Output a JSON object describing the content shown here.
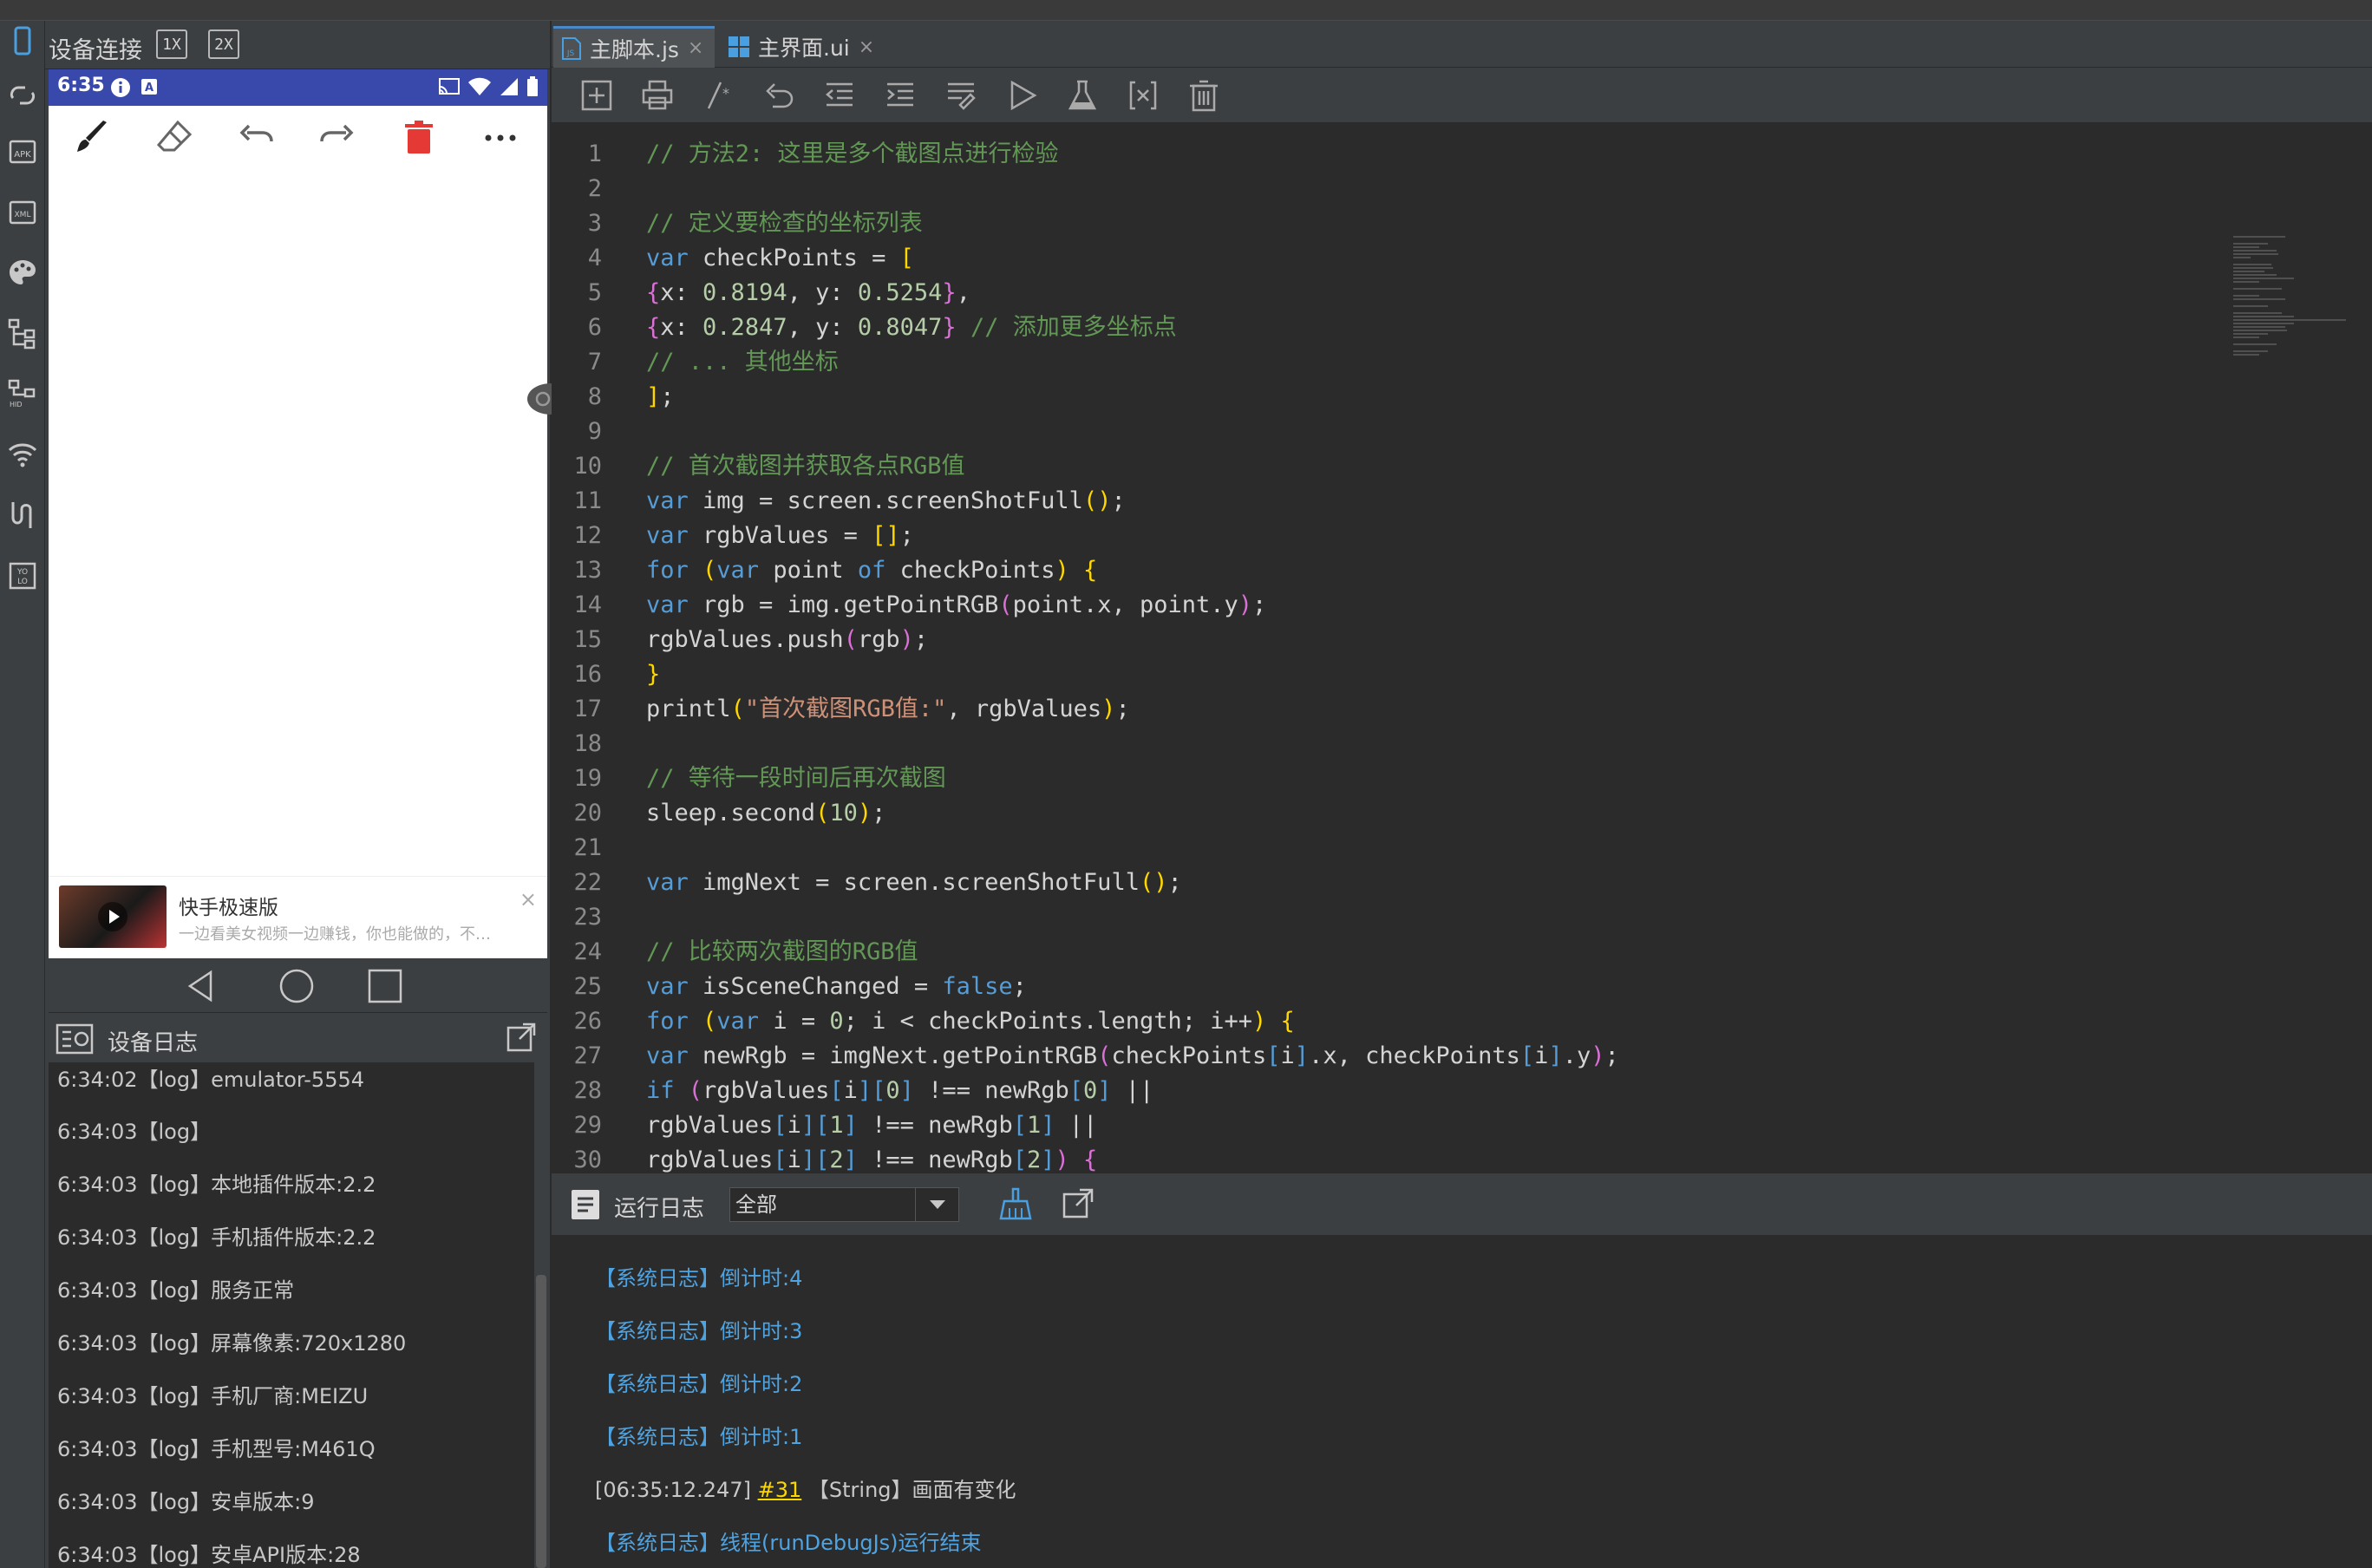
{
  "device_panel": {
    "title": "设备连接",
    "zoom_1x": "1X",
    "zoom_2x": "2X"
  },
  "phone": {
    "status_time": "6:35",
    "ad": {
      "title": "快手极速版",
      "subtitle": "一边看美女视频一边赚钱，你也能做的，不…",
      "close": "×"
    }
  },
  "device_log": {
    "title": "设备日志",
    "lines": [
      "6:34:02【log】emulator-5554",
      "6:34:03【log】",
      "6:34:03【log】本地插件版本:2.2",
      "6:34:03【log】手机插件版本:2.2",
      "6:34:03【log】服务正常",
      "6:34:03【log】屏幕像素:720x1280",
      "6:34:03【log】手机厂商:MEIZU",
      "6:34:03【log】手机型号:M461Q",
      "6:34:03【log】安卓版本:9",
      "6:34:03【log】安卓API版本:28"
    ]
  },
  "tabs": [
    {
      "label": "主脚本.js",
      "close": "×"
    },
    {
      "label": "主界面.ui",
      "close": "×"
    }
  ],
  "code_lines": [
    "1",
    "2",
    "3",
    "4",
    "5",
    "6",
    "7",
    "8",
    "9",
    "10",
    "11",
    "12",
    "13",
    "14",
    "15",
    "16",
    "17",
    "18",
    "19",
    "20",
    "21",
    "22",
    "23",
    "24",
    "25",
    "26",
    "27",
    "28",
    "29",
    "30"
  ],
  "code": {
    "l1": "// 方法2: 这里是多个截图点进行检验",
    "l3": "// 定义要检查的坐标列表",
    "l4a": "var",
    "l4b": " checkPoints = ",
    "l4c": "[",
    "l5a": "{",
    "l5b": "x: ",
    "l5c": "0.8194",
    "l5d": ", y: ",
    "l5e": "0.5254",
    "l5f": "}",
    "l5g": ",",
    "l6a": "{",
    "l6b": "x: ",
    "l6c": "0.2847",
    "l6d": ", y: ",
    "l6e": "0.8047",
    "l6f": "}",
    "l6g": " // 添加更多坐标点",
    "l7": "// ... 其他坐标",
    "l8a": "]",
    "l8b": ";",
    "l10": "// 首次截图并获取各点RGB值",
    "l11a": "var",
    "l11b": " img = screen.screenShotFull",
    "l11c": "()",
    "l11d": ";",
    "l12a": "var",
    "l12b": " rgbValues = ",
    "l12c": "[]",
    "l12d": ";",
    "l13a": "for",
    "l13b": " (",
    "l13c": "var",
    "l13d": " point ",
    "l13e": "of",
    "l13f": " checkPoints",
    "l13g": ")",
    "l13h": " {",
    "l14a": "var",
    "l14b": " rgb = img.getPointRGB",
    "l14c": "(",
    "l14d": "point.x, point.y",
    "l14e": ")",
    "l14f": ";",
    "l15a": "rgbValues.push",
    "l15b": "(",
    "l15c": "rgb",
    "l15d": ")",
    "l15e": ";",
    "l16": "}",
    "l17a": "printl",
    "l17b": "(",
    "l17c": "\"首次截图RGB值:\"",
    "l17d": ", rgbValues",
    "l17e": ")",
    "l17f": ";",
    "l19": "// 等待一段时间后再次截图",
    "l20a": "sleep.second",
    "l20b": "(",
    "l20c": "10",
    "l20d": ")",
    "l20e": ";",
    "l22a": "var",
    "l22b": " imgNext = screen.screenShotFull",
    "l22c": "()",
    "l22d": ";",
    "l24": "// 比较两次截图的RGB值",
    "l25a": "var",
    "l25b": " isSceneChanged = ",
    "l25c": "false",
    "l25d": ";",
    "l26a": "for",
    "l26b": " (",
    "l26c": "var",
    "l26d": " i = ",
    "l26e": "0",
    "l26f": "; i < checkPoints.length; i++",
    "l26g": ")",
    "l26h": " {",
    "l27a": "var",
    "l27b": " newRgb = imgNext.getPointRGB",
    "l27c": "(",
    "l27d": "checkPoints",
    "l27e": "[",
    "l27f": "i",
    "l27g": "]",
    "l27h": ".x, checkPoints",
    "l27i": "[",
    "l27j": "i",
    "l27k": "]",
    "l27l": ".y",
    "l27m": ")",
    "l27n": ";",
    "l28a": "if",
    "l28b": " (",
    "l28c": "rgbValues",
    "l28d": "[",
    "l28e": "i",
    "l28f": "][",
    "l28g": "0",
    "l28h": "]",
    "l28i": " !== newRgb",
    "l28j": "[",
    "l28k": "0",
    "l28l": "]",
    "l28m": " ||",
    "l29a": "rgbValues",
    "l29b": "[",
    "l29c": "i",
    "l29d": "][",
    "l29e": "1",
    "l29f": "]",
    "l29g": " !== newRgb",
    "l29h": "[",
    "l29i": "1",
    "l29j": "]",
    "l29k": " ||",
    "l30a": "rgbValues",
    "l30b": "[",
    "l30c": "i",
    "l30d": "][",
    "l30e": "2",
    "l30f": "]",
    "l30g": " !== newRgb",
    "l30h": "[",
    "l30i": "2",
    "l30j": "]",
    "l30k": ")",
    "l30l": " {"
  },
  "run_log": {
    "title": "运行日志",
    "filter_value": "全部",
    "lines": [
      {
        "text": "【系统日志】倒计时:4"
      },
      {
        "text": "【系统日志】倒计时:3"
      },
      {
        "text": "【系统日志】倒计时:2"
      },
      {
        "text": "【系统日志】倒计时:1"
      },
      {
        "prefix": "[06:35:12.247]",
        "link": "#31",
        "suffix": "【String】画面有变化"
      },
      {
        "text": "【系统日志】线程(runDebugJs)运行结束"
      }
    ]
  },
  "colors": {
    "comment": "#629755",
    "keyword": "#569cd6",
    "bracket": "#ffd700",
    "bracket_inner": "#da70d6",
    "number": "#b5cea8",
    "string": "#ce9178",
    "system_log": "#4fa3e0",
    "status_bar": "#3949ab",
    "delete_icon": "#e53935"
  }
}
